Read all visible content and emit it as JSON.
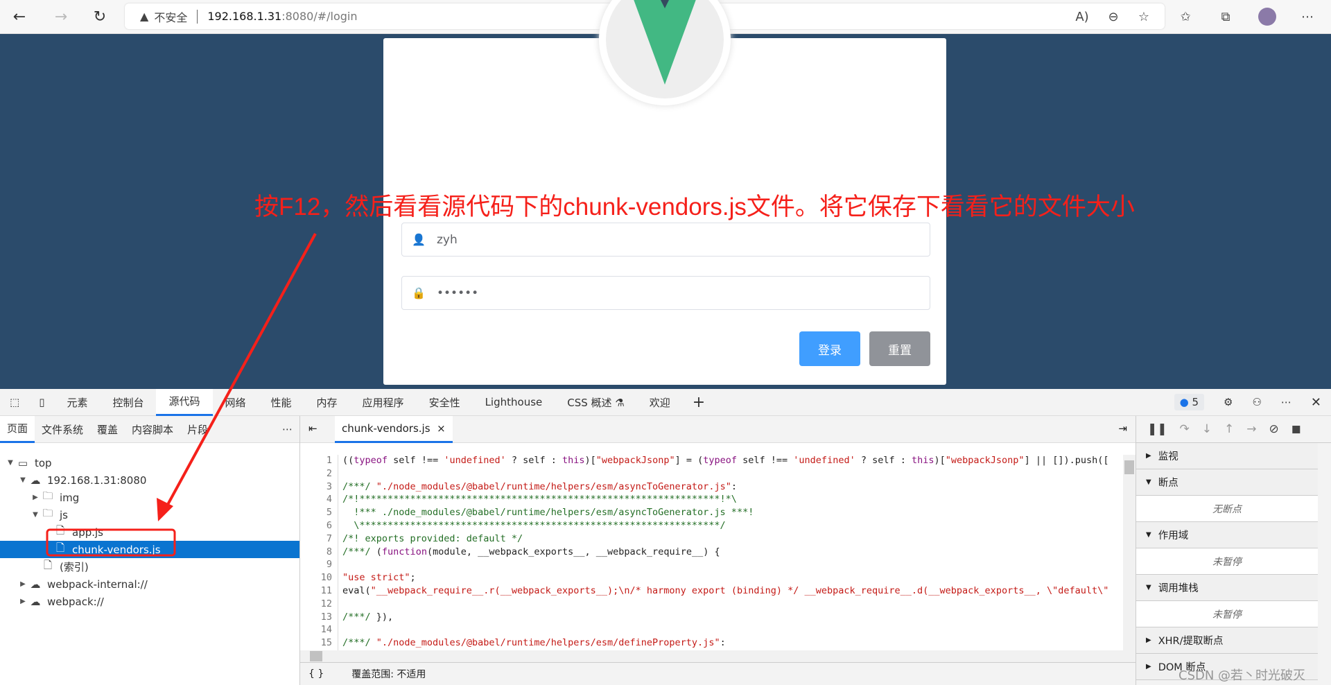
{
  "browser": {
    "security_label": "不安全",
    "url_host": "192.168.1.31",
    "url_path": ":8080/#/login"
  },
  "login": {
    "username": "zyh",
    "password": "••••••",
    "login_button": "登录",
    "reset_button": "重置"
  },
  "annotation": "按F12，然后看看源代码下的chunk-vendors.js文件。将它保存下看看它的文件大小",
  "devtools": {
    "tabs": [
      "元素",
      "控制台",
      "源代码",
      "网络",
      "性能",
      "内存",
      "应用程序",
      "安全性",
      "Lighthouse",
      "CSS 概述 ⚗",
      "欢迎"
    ],
    "active_tab": "源代码",
    "issues_count": "5",
    "nav_tabs": [
      "页面",
      "文件系统",
      "覆盖",
      "内容脚本",
      "片段"
    ],
    "tree": [
      {
        "label": "top",
        "depth": 0,
        "type": "frame",
        "expanded": true
      },
      {
        "label": "192.168.1.31:8080",
        "depth": 1,
        "type": "cloud",
        "expanded": true
      },
      {
        "label": "img",
        "depth": 2,
        "type": "folder",
        "expanded": false
      },
      {
        "label": "js",
        "depth": 2,
        "type": "folder",
        "expanded": true
      },
      {
        "label": "app.js",
        "depth": 3,
        "type": "file"
      },
      {
        "label": "chunk-vendors.js",
        "depth": 3,
        "type": "file",
        "selected": true
      },
      {
        "label": "(索引)",
        "depth": 2,
        "type": "file"
      },
      {
        "label": "webpack-internal://",
        "depth": 1,
        "type": "cloud",
        "expanded": false
      },
      {
        "label": "webpack://",
        "depth": 1,
        "type": "cloud",
        "expanded": false
      }
    ],
    "open_file": "chunk-vendors.js",
    "code": [
      [
        [
          "((",
          "p"
        ],
        [
          "typeof",
          "k"
        ],
        [
          " self !== ",
          "p"
        ],
        [
          "'undefined'",
          "s"
        ],
        [
          " ? self : ",
          "p"
        ],
        [
          "this",
          "k"
        ],
        [
          ")[",
          "p"
        ],
        [
          "\"webpackJsonp\"",
          "s"
        ],
        [
          "] = (",
          "p"
        ],
        [
          "typeof",
          "k"
        ],
        [
          " self !== ",
          "p"
        ],
        [
          "'undefined'",
          "s"
        ],
        [
          " ? self : ",
          "p"
        ],
        [
          "this",
          "k"
        ],
        [
          ")[",
          "p"
        ],
        [
          "\"webpackJsonp\"",
          "s"
        ],
        [
          "] || []).push([",
          "p"
        ]
      ],
      [],
      [
        [
          "/***/ ",
          "c"
        ],
        [
          "\"./node_modules/@babel/runtime/helpers/esm/asyncToGenerator.js\"",
          "s"
        ],
        [
          ":",
          "p"
        ]
      ],
      [
        [
          "/*!****************************************************************!*\\",
          "c"
        ]
      ],
      [
        [
          "  !*** ./node_modules/@babel/runtime/helpers/esm/asyncToGenerator.js ***!",
          "c"
        ]
      ],
      [
        [
          "  \\****************************************************************/",
          "c"
        ]
      ],
      [
        [
          "/*! exports provided: default */",
          "c"
        ]
      ],
      [
        [
          "/***/ ",
          "c"
        ],
        [
          "(",
          "p"
        ],
        [
          "function",
          "k"
        ],
        [
          "(module, __webpack_exports__, __webpack_require__) {",
          "p"
        ]
      ],
      [],
      [
        [
          "\"use strict\"",
          "s"
        ],
        [
          ";",
          "p"
        ]
      ],
      [
        [
          "eval(",
          "p"
        ],
        [
          "\"__webpack_require__.r(__webpack_exports__);\\n/* harmony export (binding) */ __webpack_require__.d(__webpack_exports__, \\\"default\\\"",
          "s"
        ]
      ],
      [],
      [
        [
          "/***/ ",
          "c"
        ],
        [
          "}),",
          "p"
        ]
      ],
      [],
      [
        [
          "/***/ ",
          "c"
        ],
        [
          "\"./node_modules/@babel/runtime/helpers/esm/defineProperty.js\"",
          "s"
        ],
        [
          ":",
          "p"
        ]
      ],
      [
        [
          "/*!**************************************************************!*\\",
          "c"
        ]
      ]
    ],
    "status": "覆盖范围: 不适用",
    "debugger_sections": [
      {
        "label": "监视",
        "expanded": false
      },
      {
        "label": "断点",
        "expanded": true,
        "empty": "无断点"
      },
      {
        "label": "作用域",
        "expanded": true,
        "empty": "未暂停"
      },
      {
        "label": "调用堆栈",
        "expanded": true,
        "empty": "未暂停"
      },
      {
        "label": "XHR/提取断点",
        "expanded": false
      },
      {
        "label": "DOM 断点",
        "expanded": false
      }
    ]
  },
  "watermark": "CSDN @若丶时光破灭",
  "colors": {
    "page_bg": "#2b4b6b",
    "primary": "#409eff",
    "info": "#909399",
    "annotation": "#f5201a",
    "selection": "#0a74d0"
  }
}
